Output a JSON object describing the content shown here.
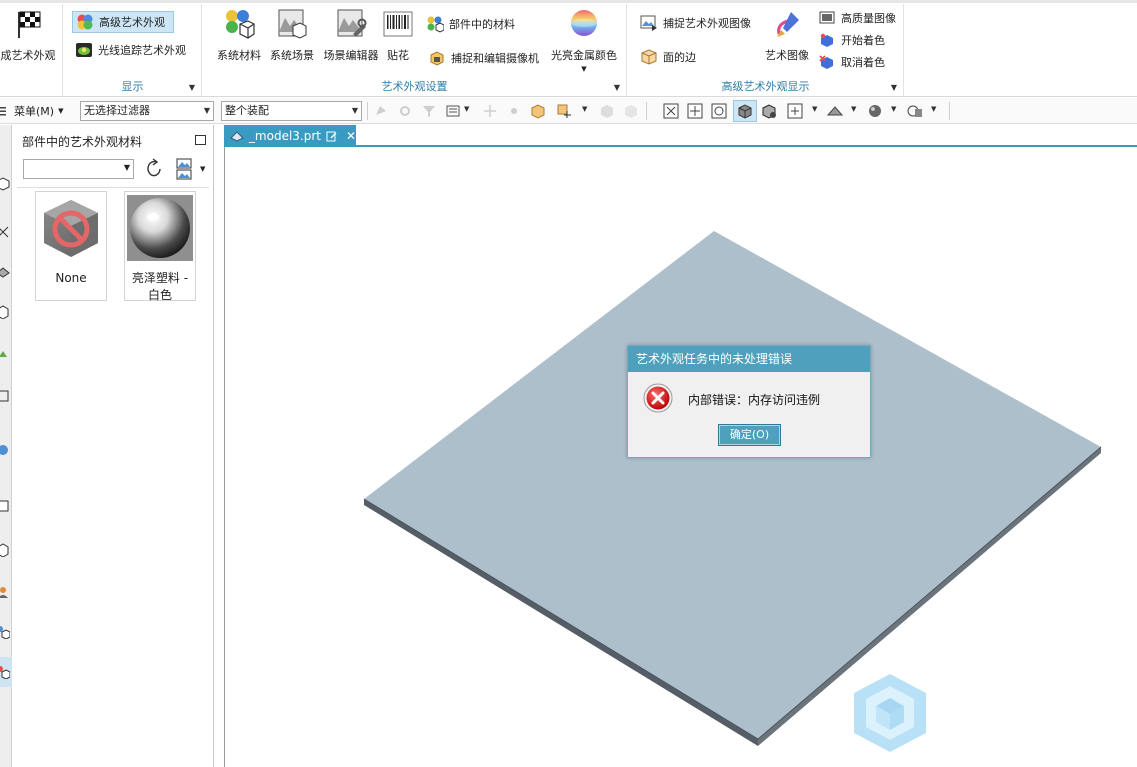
{
  "ribbon": {
    "left_cut_label": "成艺术外观",
    "display_group": {
      "label": "显示",
      "advanced_label": "高级艺术外观",
      "raytrace_label": "光线追踪艺术外观"
    },
    "settings_group": {
      "label": "艺术外观设置",
      "system_materials": "系统材料",
      "system_scenes": "系统场景",
      "scene_editor": "场景编辑器",
      "decal": "贴花",
      "part_materials": "部件中的材料",
      "capture_camera": "捕捉和编辑摄像机",
      "metal_color": "光亮金属颜色"
    },
    "advanced_display_group": {
      "label": "高级艺术外观显示",
      "capture_image": "捕捉艺术外观图像",
      "face_edges": "面的边",
      "art_image": "艺术图像",
      "hq_image": "高质量图像",
      "start_shading": "开始着色",
      "cancel_shading": "取消着色"
    }
  },
  "toolbar": {
    "menu_label": "菜单(M)",
    "filter_value": "无选择过滤器",
    "assembly_value": "整个装配"
  },
  "panel": {
    "title": "部件中的艺术外观材料",
    "dropdown_value": "",
    "materials": [
      {
        "label": "None",
        "swatch": "none-swatch"
      },
      {
        "label": "亮泽塑料 - 白色",
        "swatch": "glossy-white-sphere"
      }
    ]
  },
  "viewport": {
    "tab_label": "_model3.prt",
    "model_color": "#aebfcc"
  },
  "dialog": {
    "title": "艺术外观任务中的未处理错误",
    "message": "内部错误：内存访问违例",
    "ok_label": "确定(O)"
  },
  "colors": {
    "accent": "#3a9bc2",
    "dialog_title_bg": "#4fa0bd",
    "group_label": "#2e7da6"
  }
}
